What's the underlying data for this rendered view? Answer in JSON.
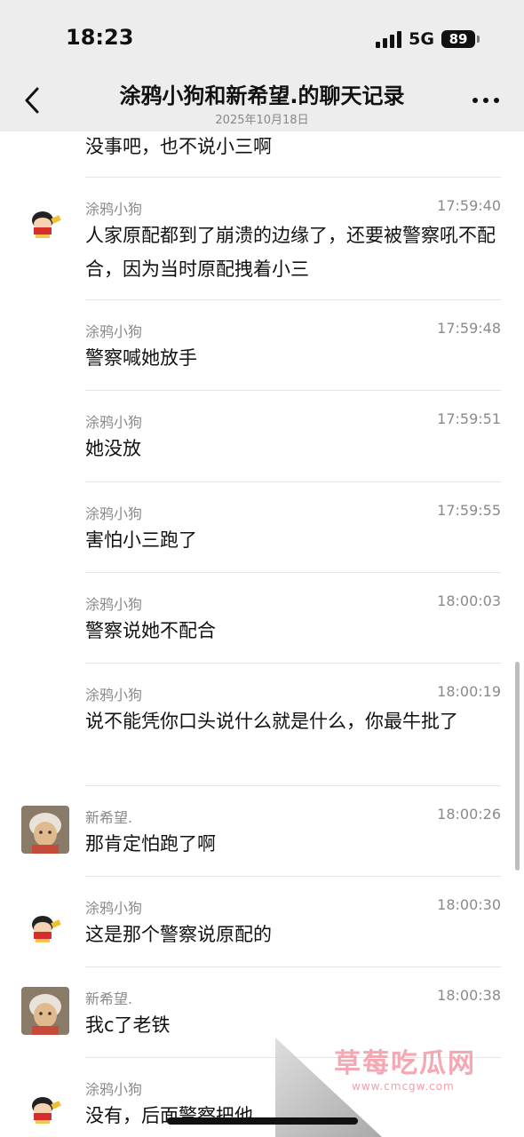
{
  "status_bar": {
    "time": "18:23",
    "network": "5G",
    "battery": "89"
  },
  "header": {
    "title": "涂鸦小狗和新希望.的聊天记录",
    "date": "2025年10月18日"
  },
  "icons": {
    "back": "chevron-left-icon",
    "more": "more-dots-icon"
  },
  "messages": [
    {
      "sender": "",
      "time": "",
      "text": "没事吧，也不说小三啊",
      "avatar": "none"
    },
    {
      "sender": "涂鸦小狗",
      "time": "17:59:40",
      "text": "人家原配都到了崩溃的边缘了，还要被警察吼不配合，因为当时原配拽着小三",
      "avatar": "cartoon-boy"
    },
    {
      "sender": "涂鸦小狗",
      "time": "17:59:48",
      "text": "警察喊她放手",
      "avatar": "none"
    },
    {
      "sender": "涂鸦小狗",
      "time": "17:59:51",
      "text": "她没放",
      "avatar": "none"
    },
    {
      "sender": "涂鸦小狗",
      "time": "17:59:55",
      "text": "害怕小三跑了",
      "avatar": "none"
    },
    {
      "sender": "涂鸦小狗",
      "time": "18:00:03",
      "text": "警察说她不配合",
      "avatar": "none"
    },
    {
      "sender": "涂鸦小狗",
      "time": "18:00:19",
      "text": "说不能凭你口头说什么就是什么，你最牛批了",
      "avatar": "none"
    },
    {
      "sender": "新希望.",
      "time": "18:00:26",
      "text": "那肯定怕跑了啊",
      "avatar": "old-lady"
    },
    {
      "sender": "涂鸦小狗",
      "time": "18:00:30",
      "text": "这是那个警察说原配的",
      "avatar": "cartoon-boy"
    },
    {
      "sender": "新希望.",
      "time": "18:00:38",
      "text": "我c了老铁",
      "avatar": "old-lady"
    },
    {
      "sender": "涂鸦小狗",
      "time": "",
      "text": "没有，后面警察把他",
      "avatar": "cartoon-boy"
    }
  ],
  "watermark": {
    "title": "草莓吃瓜网",
    "url": "www.cmcgw.com"
  },
  "colors": {
    "topbar_bg": "#ededed",
    "meta_text": "#8a8a8a",
    "divider": "#e6e6e6",
    "watermark": "#f29aa5"
  }
}
